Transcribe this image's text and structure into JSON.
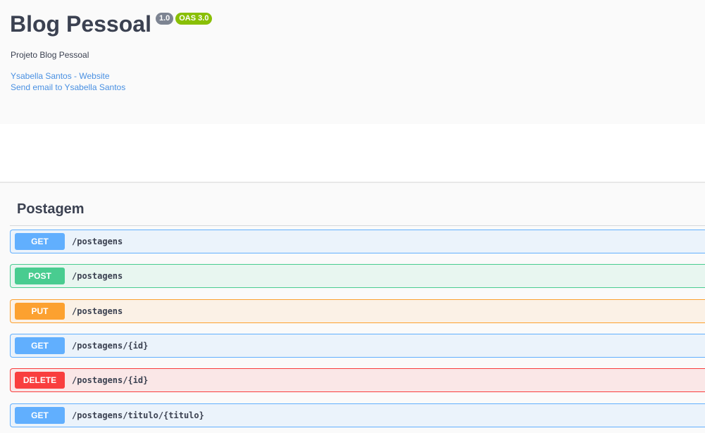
{
  "info": {
    "title": "Blog Pessoal",
    "version_badge": "1.0",
    "oas_badge": "OAS 3.0",
    "description": "Projeto Blog Pessoal",
    "contact_website": "Ysabella Santos - Website",
    "contact_email": "Send email to Ysabella Santos"
  },
  "tag": {
    "name": "Postagem"
  },
  "operations": [
    {
      "method": "GET",
      "path": "/postagens"
    },
    {
      "method": "POST",
      "path": "/postagens"
    },
    {
      "method": "PUT",
      "path": "/postagens"
    },
    {
      "method": "GET",
      "path": "/postagens/{id}"
    },
    {
      "method": "DELETE",
      "path": "/postagens/{id}"
    },
    {
      "method": "GET",
      "path": "/postagens/titulo/{titulo}"
    }
  ],
  "colors": {
    "get": "#61affe",
    "post": "#49cc90",
    "put": "#fca130",
    "delete": "#f93e3e",
    "link": "#4990e2"
  }
}
